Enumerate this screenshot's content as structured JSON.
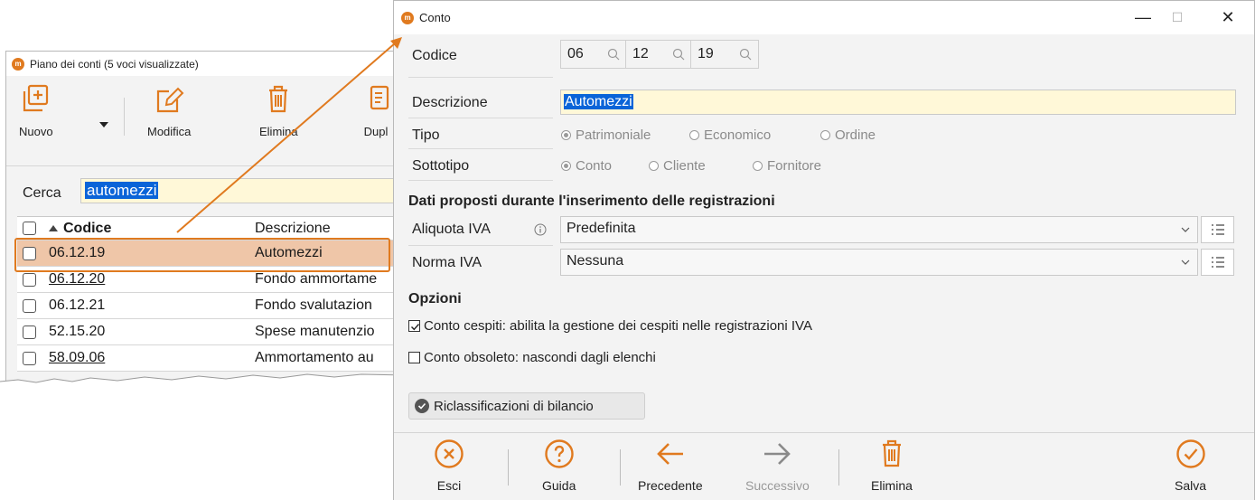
{
  "background_window": {
    "title": "Piano dei conti (5 voci visualizzate)",
    "toolbar": {
      "new_label": "Nuovo",
      "edit_label": "Modifica",
      "delete_label": "Elimina",
      "duplicate_label": "Dupl"
    },
    "search": {
      "label": "Cerca",
      "value": "automezzi"
    },
    "grid": {
      "columns": {
        "code": "Codice",
        "description": "Descrizione"
      },
      "rows": [
        {
          "code": "06.12.19",
          "description": "Automezzi",
          "selected": true,
          "underlined": false
        },
        {
          "code": "06.12.20",
          "description": "Fondo ammortame",
          "selected": false,
          "underlined": true
        },
        {
          "code": "06.12.21",
          "description": "Fondo svalutazion",
          "selected": false,
          "underlined": false
        },
        {
          "code": "52.15.20",
          "description": "Spese manutenzio",
          "selected": false,
          "underlined": false
        },
        {
          "code": "58.09.06",
          "description": "Ammortamento au",
          "selected": false,
          "underlined": true
        }
      ]
    }
  },
  "conto_window": {
    "title": "Conto",
    "controls": {
      "minimize": "—",
      "maximize": "☐",
      "close": "✕"
    },
    "codice": {
      "label": "Codice",
      "parts": [
        "06",
        "12",
        "19"
      ]
    },
    "descrizione": {
      "label": "Descrizione",
      "value": "Automezzi"
    },
    "tipo": {
      "label": "Tipo",
      "options": [
        "Patrimoniale",
        "Economico",
        "Ordine"
      ],
      "selected": "Patrimoniale"
    },
    "sottotipo": {
      "label": "Sottotipo",
      "options": [
        "Conto",
        "Cliente",
        "Fornitore"
      ],
      "selected": "Conto"
    },
    "dati_proposti": {
      "title": "Dati proposti durante l'inserimento delle registrazioni",
      "aliquota_label": "Aliquota IVA",
      "aliquota_value": "Predefinita",
      "norma_label": "Norma IVA",
      "norma_value": "Nessuna"
    },
    "opzioni": {
      "title": "Opzioni",
      "cespiti_label": "Conto cespiti: abilita la gestione dei cespiti nelle registrazioni IVA",
      "cespiti_checked": true,
      "obsoleto_label": "Conto obsoleto: nascondi dagli elenchi",
      "obsoleto_checked": false
    },
    "riclassificazioni_label": "Riclassificazioni di bilancio",
    "bottom_bar": {
      "exit_label": "Esci",
      "help_label": "Guida",
      "prev_label": "Precedente",
      "next_label": "Successivo",
      "delete_label": "Elimina",
      "save_label": "Salva"
    }
  },
  "colors": {
    "accent": "#e07a1f",
    "selection": "#0a64d8",
    "selected_row": "#efc6a8",
    "input_bg": "#fff8d8"
  }
}
